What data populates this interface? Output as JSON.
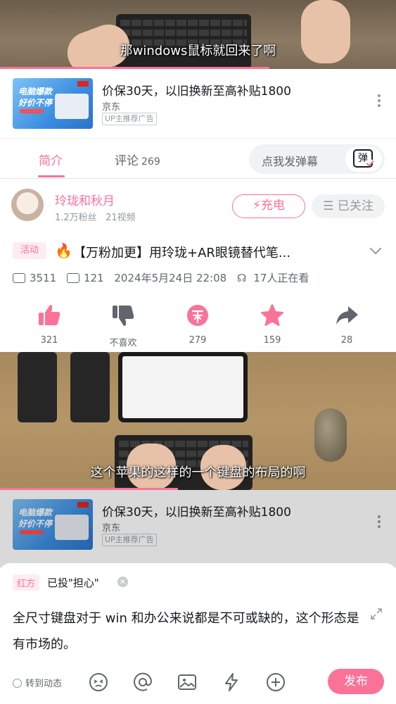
{
  "colors": {
    "accent": "#fb7299",
    "text": "#18191c",
    "secondary": "#61666d",
    "muted": "#9499a0"
  },
  "video_top": {
    "subtitle": "那windows鼠标就回来了啊",
    "progress": 0.68
  },
  "video_mid": {
    "subtitle": "这个苹果的这样的一个键盘的布局的啊",
    "progress": 0.45
  },
  "ad": {
    "title": "价保30天，以旧换新至高补贴1800",
    "brand": "京东",
    "tag": "UP主推荐广告",
    "thumb_line1": "电脑爆款",
    "thumb_line2": "好价不停"
  },
  "tabs": {
    "intro": "简介",
    "comments": "评论",
    "comment_count": "269",
    "danmaku_placeholder": "点我发弹幕",
    "danmaku_icon_text": "弹"
  },
  "uploader": {
    "name": "玲珑和秋月",
    "fans": "1.2万粉丝",
    "videos": "21视频",
    "charge_label": "充电",
    "follow_label": "已关注"
  },
  "video": {
    "activity_tag": "活动",
    "title": "【万粉加更】用玲珑+AR眼镜替代笔...",
    "plays": "3511",
    "danmaku_count": "121",
    "date": "2024年5月24日 22:08",
    "watching": "17人正在看"
  },
  "actions": [
    {
      "icon": "thumbs-up-icon",
      "label": "321"
    },
    {
      "icon": "thumbs-down-icon",
      "label": "不喜欢"
    },
    {
      "icon": "coin-icon",
      "label": "279"
    },
    {
      "icon": "star-icon",
      "label": "159"
    },
    {
      "icon": "share-icon",
      "label": "28"
    }
  ],
  "comment_box": {
    "side_tag": "红方",
    "voted": "已投\"担心\"",
    "text": "全尺寸键盘对于 win 和办公来说都是不可或缺的，这个形态是有市场的。",
    "repost_label": "转到动态",
    "publish_label": "发布"
  }
}
